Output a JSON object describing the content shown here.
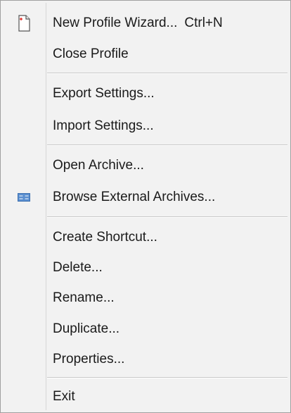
{
  "menu": {
    "items": [
      {
        "label": "New Profile Wizard...",
        "shortcut": "Ctrl+N",
        "icon": "new-document-icon"
      },
      {
        "label": "Close Profile"
      },
      {
        "label": "Export Settings..."
      },
      {
        "label": "Import Settings..."
      },
      {
        "label": "Open Archive..."
      },
      {
        "label": "Browse External Archives...",
        "icon": "archive-grid-icon"
      },
      {
        "label": "Create Shortcut..."
      },
      {
        "label": "Delete..."
      },
      {
        "label": "Rename..."
      },
      {
        "label": "Duplicate..."
      },
      {
        "label": "Properties..."
      },
      {
        "label": "Exit"
      }
    ]
  },
  "colors": {
    "background": "#f2f2f2",
    "text": "#1a1a1a",
    "separator": "#c8c8c8",
    "icon_accent": "#e0302a",
    "icon_blue": "#3a6fb0"
  }
}
